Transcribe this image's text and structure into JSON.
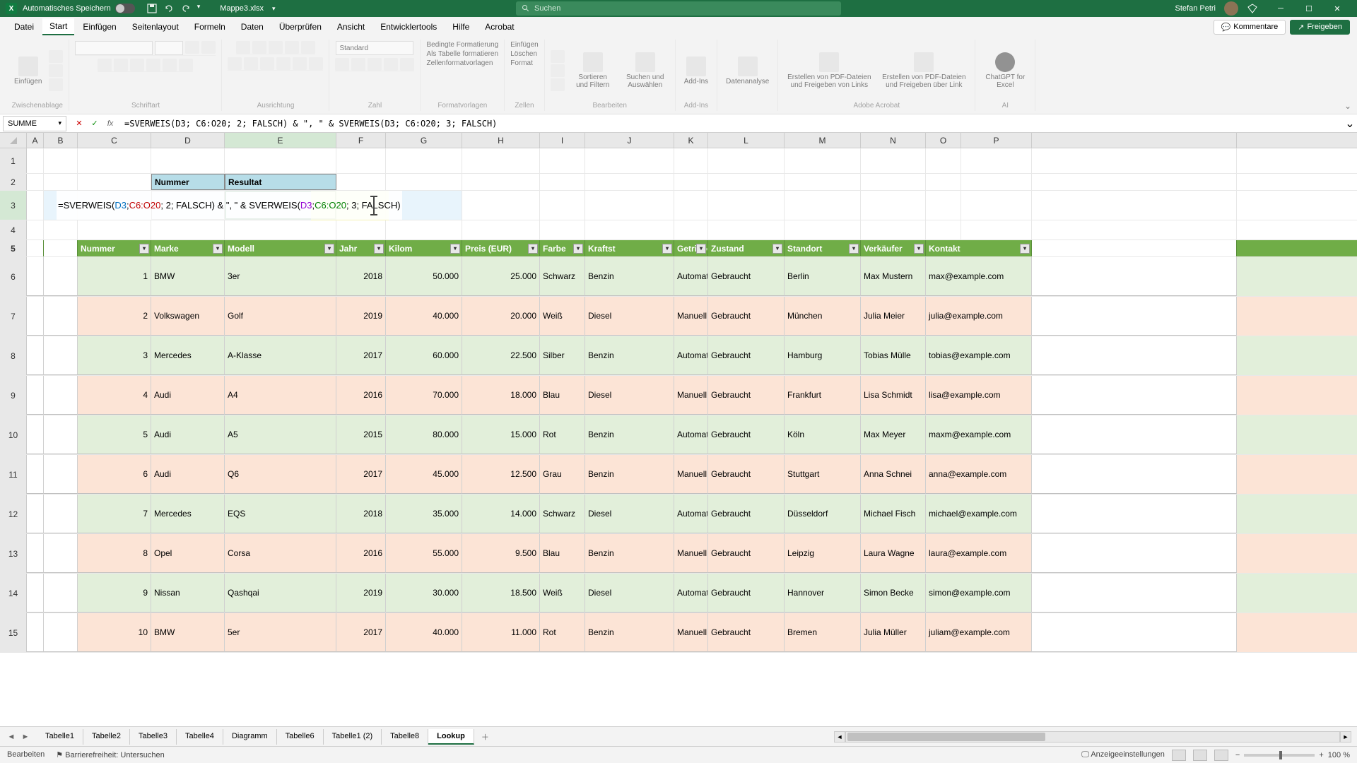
{
  "titlebar": {
    "autosave_label": "Automatisches Speichern",
    "filename": "Mappe3.xlsx",
    "search_placeholder": "Suchen",
    "username": "Stefan Petri"
  },
  "menu": {
    "tabs": [
      "Datei",
      "Start",
      "Einfügen",
      "Seitenlayout",
      "Formeln",
      "Daten",
      "Überprüfen",
      "Ansicht",
      "Entwicklertools",
      "Hilfe",
      "Acrobat"
    ],
    "active": "Start",
    "comments": "Kommentare",
    "share": "Freigeben"
  },
  "ribbon": {
    "paste": "Einfügen",
    "clipboard": "Zwischenablage",
    "font": "Schriftart",
    "alignment": "Ausrichtung",
    "number_format": "Standard",
    "number": "Zahl",
    "cond_format": "Bedingte Formatierung",
    "as_table": "Als Tabelle formatieren",
    "cell_styles": "Zellenformatvorlagen",
    "styles": "Formatvorlagen",
    "einfugen": "Einfügen",
    "loschen": "Löschen",
    "format": "Format",
    "cells": "Zellen",
    "sort_filter": "Sortieren und Filtern",
    "find_select": "Suchen und Auswählen",
    "editing": "Bearbeiten",
    "addins": "Add-Ins",
    "data_analysis": "Datenanalyse",
    "pdf_create": "Erstellen von PDF-Dateien und Freigeben von Links",
    "pdf_create2": "Erstellen von PDF-Dateien und Freigeben über Link",
    "adobe": "Adobe Acrobat",
    "chatgpt": "ChatGPT for Excel",
    "ai": "AI"
  },
  "formulabar": {
    "namebox": "SUMME",
    "formula": "=SVERWEIS(D3; C6:O20; 2; FALSCH) & \", \" & SVERWEIS(D3; C6:O20; 3; FALSCH)"
  },
  "columns": [
    "A",
    "B",
    "C",
    "D",
    "E",
    "F",
    "G",
    "H",
    "I",
    "J",
    "K",
    "L",
    "M",
    "N",
    "O",
    "P"
  ],
  "lookup": {
    "nummer_label": "Nummer",
    "resultat_label": "Resultat",
    "formula_parts": {
      "p1": "=SVERWEIS(",
      "d3a": "D3",
      "p2": "; ",
      "r1": "C6:O20",
      "p3": "; 2; FALSCH) & \", \" & SVERWEIS(",
      "d3b": "D3",
      "p4": "; ",
      "r2": "C6:O20",
      "p5": "; 3; FALSCH)"
    }
  },
  "table": {
    "headers": [
      "Nummer",
      "Marke",
      "Modell",
      "Jahr",
      "Kilom",
      "Preis (EUR)",
      "Farbe",
      "Kraftst",
      "Getriebe",
      "Zustand",
      "Standort",
      "Verkäufer",
      "Kontakt"
    ],
    "rows": [
      {
        "n": "1",
        "marke": "BMW",
        "modell": "3er",
        "jahr": "2018",
        "km": "50.000",
        "preis": "25.000",
        "farbe": "Schwarz",
        "kraft": "Benzin",
        "getr": "Automatik",
        "zust": "Gebraucht",
        "ort": "Berlin",
        "verk": "Max Mustern",
        "kontakt": "max@example.com"
      },
      {
        "n": "2",
        "marke": "Volkswagen",
        "modell": "Golf",
        "jahr": "2019",
        "km": "40.000",
        "preis": "20.000",
        "farbe": "Weiß",
        "kraft": "Diesel",
        "getr": "Manuell",
        "zust": "Gebraucht",
        "ort": "München",
        "verk": "Julia Meier",
        "kontakt": "julia@example.com"
      },
      {
        "n": "3",
        "marke": "Mercedes",
        "modell": "A-Klasse",
        "jahr": "2017",
        "km": "60.000",
        "preis": "22.500",
        "farbe": "Silber",
        "kraft": "Benzin",
        "getr": "Automatik",
        "zust": "Gebraucht",
        "ort": "Hamburg",
        "verk": "Tobias Mülle",
        "kontakt": "tobias@example.com"
      },
      {
        "n": "4",
        "marke": "Audi",
        "modell": "A4",
        "jahr": "2016",
        "km": "70.000",
        "preis": "18.000",
        "farbe": "Blau",
        "kraft": "Diesel",
        "getr": "Manuell",
        "zust": "Gebraucht",
        "ort": "Frankfurt",
        "verk": "Lisa Schmidt",
        "kontakt": "lisa@example.com"
      },
      {
        "n": "5",
        "marke": "Audi",
        "modell": "A5",
        "jahr": "2015",
        "km": "80.000",
        "preis": "15.000",
        "farbe": "Rot",
        "kraft": "Benzin",
        "getr": "Automatik",
        "zust": "Gebraucht",
        "ort": "Köln",
        "verk": "Max Meyer",
        "kontakt": "maxm@example.com"
      },
      {
        "n": "6",
        "marke": "Audi",
        "modell": "Q6",
        "jahr": "2017",
        "km": "45.000",
        "preis": "12.500",
        "farbe": "Grau",
        "kraft": "Benzin",
        "getr": "Manuell",
        "zust": "Gebraucht",
        "ort": "Stuttgart",
        "verk": "Anna Schnei",
        "kontakt": "anna@example.com"
      },
      {
        "n": "7",
        "marke": "Mercedes",
        "modell": "EQS",
        "jahr": "2018",
        "km": "35.000",
        "preis": "14.000",
        "farbe": "Schwarz",
        "kraft": "Diesel",
        "getr": "Automatik",
        "zust": "Gebraucht",
        "ort": "Düsseldorf",
        "verk": "Michael Fisch",
        "kontakt": "michael@example.com"
      },
      {
        "n": "8",
        "marke": "Opel",
        "modell": "Corsa",
        "jahr": "2016",
        "km": "55.000",
        "preis": "9.500",
        "farbe": "Blau",
        "kraft": "Benzin",
        "getr": "Manuell",
        "zust": "Gebraucht",
        "ort": "Leipzig",
        "verk": "Laura Wagne",
        "kontakt": "laura@example.com"
      },
      {
        "n": "9",
        "marke": "Nissan",
        "modell": "Qashqai",
        "jahr": "2019",
        "km": "30.000",
        "preis": "18.500",
        "farbe": "Weiß",
        "kraft": "Diesel",
        "getr": "Automatik",
        "zust": "Gebraucht",
        "ort": "Hannover",
        "verk": "Simon Becke",
        "kontakt": "simon@example.com"
      },
      {
        "n": "10",
        "marke": "BMW",
        "modell": "5er",
        "jahr": "2017",
        "km": "40.000",
        "preis": "11.000",
        "farbe": "Rot",
        "kraft": "Benzin",
        "getr": "Manuell",
        "zust": "Gebraucht",
        "ort": "Bremen",
        "verk": "Julia Müller",
        "kontakt": "juliam@example.com"
      }
    ]
  },
  "sheets": {
    "tabs": [
      "Tabelle1",
      "Tabelle2",
      "Tabelle3",
      "Tabelle4",
      "Diagramm",
      "Tabelle6",
      "Tabelle1 (2)",
      "Tabelle8",
      "Lookup"
    ],
    "active": "Lookup"
  },
  "statusbar": {
    "mode": "Bearbeiten",
    "accessibility": "Barrierefreiheit: Untersuchen",
    "display_settings": "Anzeigeeinstellungen",
    "zoom": "100 %"
  }
}
